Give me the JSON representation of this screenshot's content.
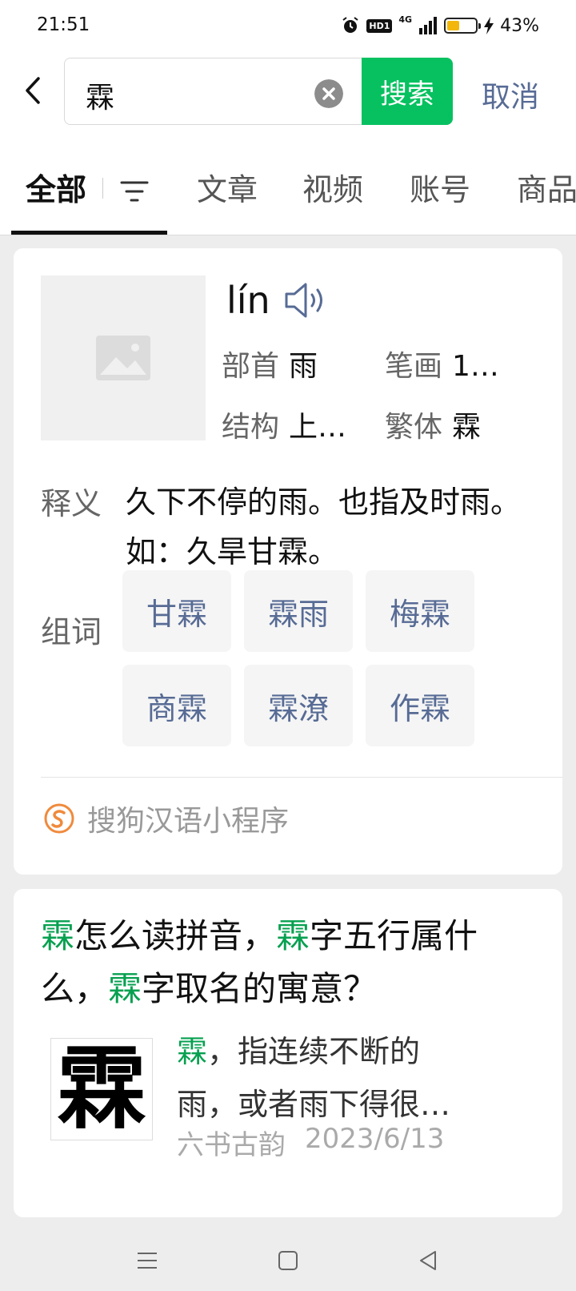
{
  "status_bar": {
    "time": "21:51",
    "hd_label": "HD1",
    "network": "4G",
    "battery_percent": "43%",
    "battery_level": 0.43,
    "battery_color": "#f2b70a"
  },
  "search": {
    "query": "霖",
    "search_label": "搜索",
    "cancel_label": "取消",
    "accent_color": "#07c160"
  },
  "tabs": [
    {
      "label": "全部",
      "active": true
    },
    {
      "label": "文章"
    },
    {
      "label": "视频"
    },
    {
      "label": "账号"
    },
    {
      "label": "商品"
    }
  ],
  "dictionary": {
    "pinyin": "lín",
    "radical_label": "部首",
    "radical": "雨",
    "strokes_label": "笔画",
    "strokes": "1…",
    "structure_label": "结构",
    "structure": "上…",
    "traditional_label": "繁体",
    "traditional": "霖",
    "definition_label": "释义",
    "definition": "久下不停的雨。也指及时雨。如：久旱甘霖。",
    "words_label": "组词",
    "words": [
      "甘霖",
      "霖雨",
      "梅霖",
      "商霖",
      "霖潦",
      "作霖"
    ],
    "source": "搜狗汉语小程序"
  },
  "article": {
    "title_parts": [
      {
        "text": "霖",
        "hl": true
      },
      {
        "text": "怎么读拼音，",
        "hl": false
      },
      {
        "text": "霖",
        "hl": true
      },
      {
        "text": "字五行属什么，",
        "hl": false
      },
      {
        "text": "霖",
        "hl": true
      },
      {
        "text": "字取名的寓意？",
        "hl": false
      }
    ],
    "thumb_char": "霖",
    "snippet_hl": "霖",
    "snippet_line1": "，指连续不断的",
    "snippet_line2": "雨，或者雨下得很…",
    "source": "六书古韵",
    "date": "2023/6/13"
  }
}
